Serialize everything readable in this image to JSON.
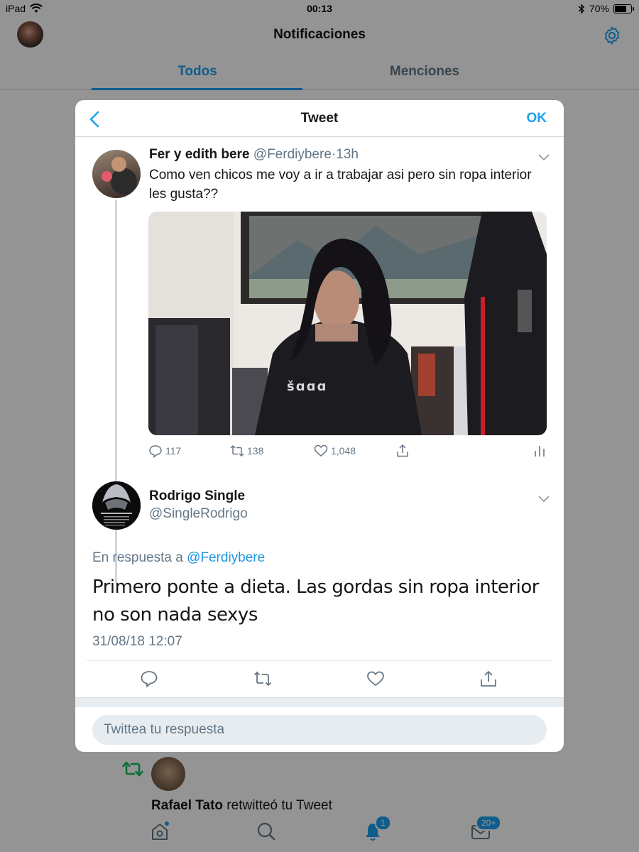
{
  "status_bar": {
    "device": "iPad",
    "time": "00:13",
    "battery": "70%"
  },
  "header": {
    "title": "Notificaciones"
  },
  "tabs": [
    {
      "label": "Todos",
      "active": true
    },
    {
      "label": "Menciones",
      "active": false
    }
  ],
  "modal": {
    "title": "Tweet",
    "ok_label": "OK",
    "original_tweet": {
      "name": "Fer y edith bere",
      "handle": "@Ferdiybere",
      "time": "13h",
      "text": "Como ven chicos me voy a ir a trabajar asi pero sin ropa interior les gusta??",
      "stats": {
        "replies": "117",
        "retweets": "138",
        "likes": "1,048"
      },
      "image_shirt_text": "šɑɑɑ"
    },
    "reply_tweet": {
      "name": "Rodrigo Single",
      "handle": "@SingleRodrigo",
      "reply_prefix": "En respuesta a",
      "reply_to": "@Ferdiybere",
      "text": "Primero ponte a dieta. Las gordas sin ropa interior no son nada sexys",
      "date": "31/08/18 12:07"
    },
    "reply_placeholder": "Twittea tu respuesta"
  },
  "background_notification": {
    "name": "Rafael Tato",
    "action": "retwitteó tu Tweet"
  },
  "tabbar": {
    "notifications_badge": "1",
    "messages_badge": "20+"
  },
  "colors": {
    "accent": "#1da1f2",
    "text": "#14171a",
    "secondary": "#657786",
    "retweet_green": "#17bf63"
  }
}
